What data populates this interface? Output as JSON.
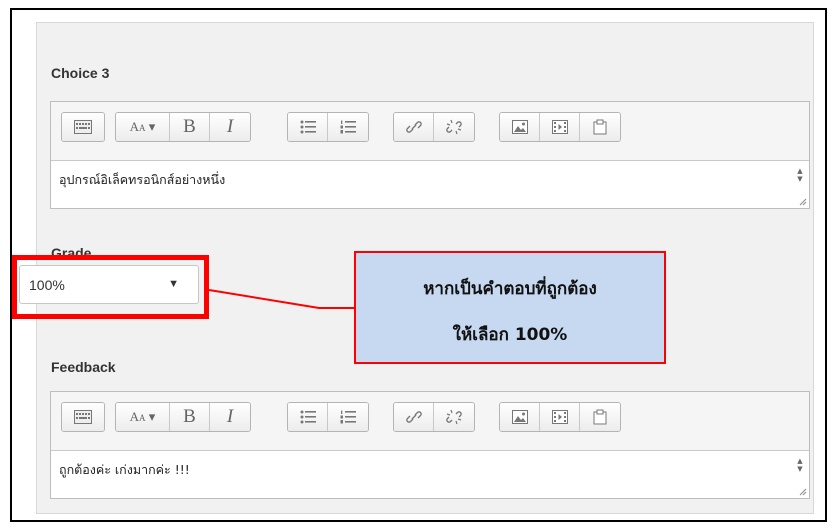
{
  "choice": {
    "label": "Choice 3",
    "text": "อุปกรณ์อิเล็คทรอนิกส์อย่างหนึ่ง"
  },
  "grade": {
    "label": "Grade",
    "selected": "100%"
  },
  "feedback": {
    "label": "Feedback",
    "text": "ถูกต้องค่ะ เก่งมากค่ะ !!!"
  },
  "toolbar": {
    "bold_label": "B",
    "italic_label": "I",
    "buttons": [
      "toggle-toolbar",
      "font-size",
      "bold",
      "italic",
      "unordered-list",
      "ordered-list",
      "link",
      "unlink",
      "image",
      "media",
      "paste"
    ]
  },
  "callout": {
    "line1": "หากเป็นคำตอบที่ถูกต้อง",
    "line2": "ให้เลือก 100%"
  },
  "colors": {
    "highlight": "#ff0000",
    "callout_bg": "#c6d9f1"
  }
}
